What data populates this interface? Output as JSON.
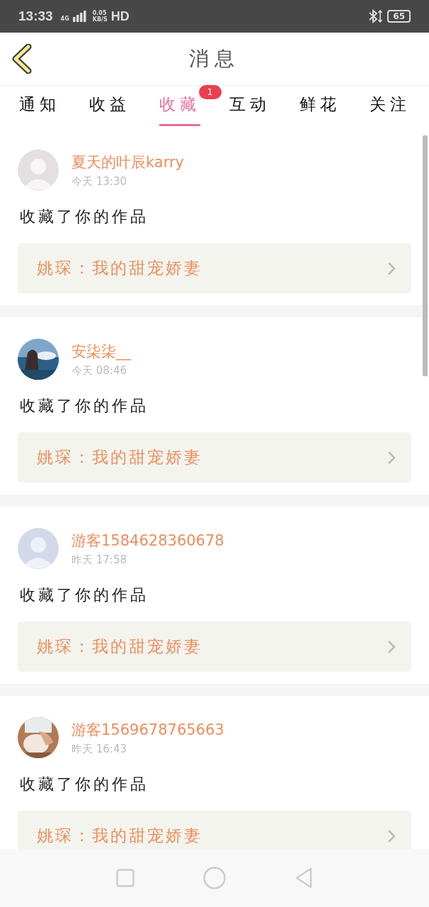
{
  "status_bar": {
    "time": "13:33",
    "network": "4G",
    "speed": "0.05",
    "speed_unit": "KB/S",
    "hd": "HD",
    "battery": "65"
  },
  "header": {
    "title": "消息"
  },
  "tabs": [
    {
      "label": "通知",
      "selected": false
    },
    {
      "label": "收益",
      "selected": false
    },
    {
      "label": "收藏",
      "selected": true,
      "badge": "1"
    },
    {
      "label": "互动",
      "selected": false
    },
    {
      "label": "鲜花",
      "selected": false
    },
    {
      "label": "关注",
      "selected": false
    }
  ],
  "messages": [
    {
      "avatar": {
        "kind": "default"
      },
      "name": "夏天的叶辰karry",
      "time": "今天 13:30",
      "text": "收藏了你的作品",
      "work": "姚琛：我的甜宠娇妻"
    },
    {
      "name": "安柒柒__",
      "time": "今天 08:46",
      "text": "收藏了你的作品",
      "work": "姚琛：我的甜宠娇妻"
    },
    {
      "avatar": {
        "kind": "default"
      },
      "name": "游客1584628360678",
      "time": "昨天 17:58",
      "text": "收藏了你的作品",
      "work": "姚琛：我的甜宠娇妻"
    },
    {
      "name": "游客1569678765663",
      "time": "昨天 16:43",
      "text": "收藏了你的作品",
      "work": "姚琛：我的甜宠娇妻"
    }
  ]
}
